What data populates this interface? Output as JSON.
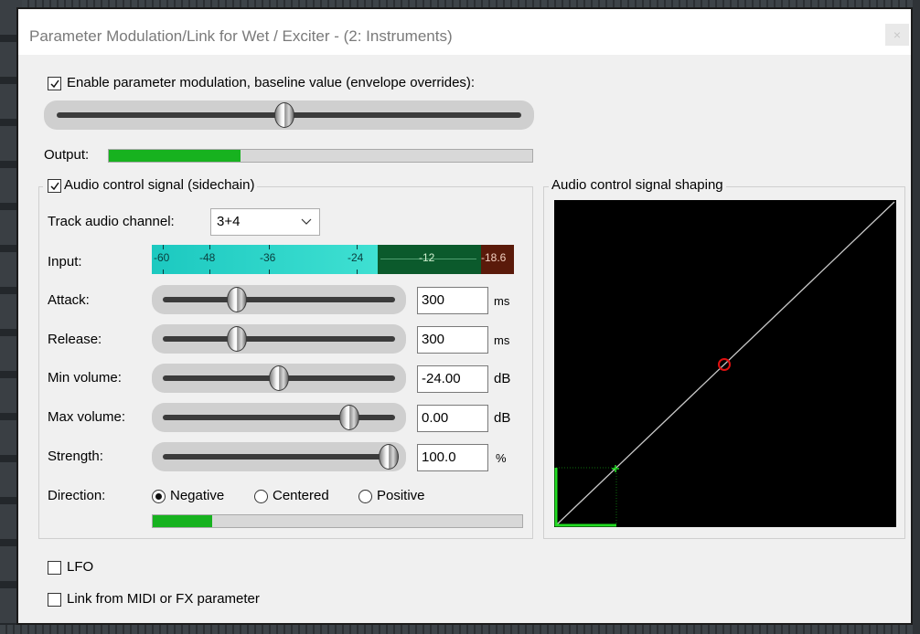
{
  "window": {
    "title": "Parameter Modulation/Link for Wet / Exciter - (2: Instruments)",
    "close_glyph": "×"
  },
  "baseline": {
    "enable_label": "Enable parameter modulation, baseline value (envelope overrides):",
    "enabled": true,
    "value_fraction": 0.49
  },
  "output": {
    "label": "Output:",
    "level_fraction": 0.31,
    "meter_color": "#17b21f"
  },
  "audio_control": {
    "group_label": "Audio control signal (sidechain)",
    "enabled": true,
    "channel_label": "Track audio channel:",
    "channel_value": "3+4",
    "input_label": "Input:",
    "input_ticks": [
      "-60",
      "-48",
      "-36",
      "-24",
      "-12"
    ],
    "input_peak": "-18.6",
    "params": [
      {
        "label": "Attack:",
        "value": "300",
        "unit": "ms",
        "fraction": 0.31
      },
      {
        "label": "Release:",
        "value": "300",
        "unit": "ms",
        "fraction": 0.31
      },
      {
        "label": "Min volume:",
        "value": "-24.00",
        "unit": "dB",
        "fraction": 0.5
      },
      {
        "label": "Max volume:",
        "value": "0.00",
        "unit": "dB",
        "fraction": 0.82
      },
      {
        "label": "Strength:",
        "value": "100.0",
        "unit": "%",
        "fraction": 1.0
      }
    ],
    "direction_label": "Direction:",
    "direction_options": [
      "Negative",
      "Centered",
      "Positive"
    ],
    "direction_selected": "Negative",
    "activity_fraction": 0.16
  },
  "shaping": {
    "group_label": "Audio control signal shaping",
    "background": "#000000",
    "curve_color": "#c8c8c8",
    "point_color": "#e01010",
    "range_color": "#22dd22"
  },
  "lfo": {
    "label": "LFO",
    "enabled": false
  },
  "link": {
    "label": "Link from MIDI or FX parameter",
    "enabled": false
  },
  "colors": {
    "vu_cyan": "#1cc9c0",
    "vu_green": "#0b5a2c",
    "vu_peak": "#5a1a0a"
  }
}
